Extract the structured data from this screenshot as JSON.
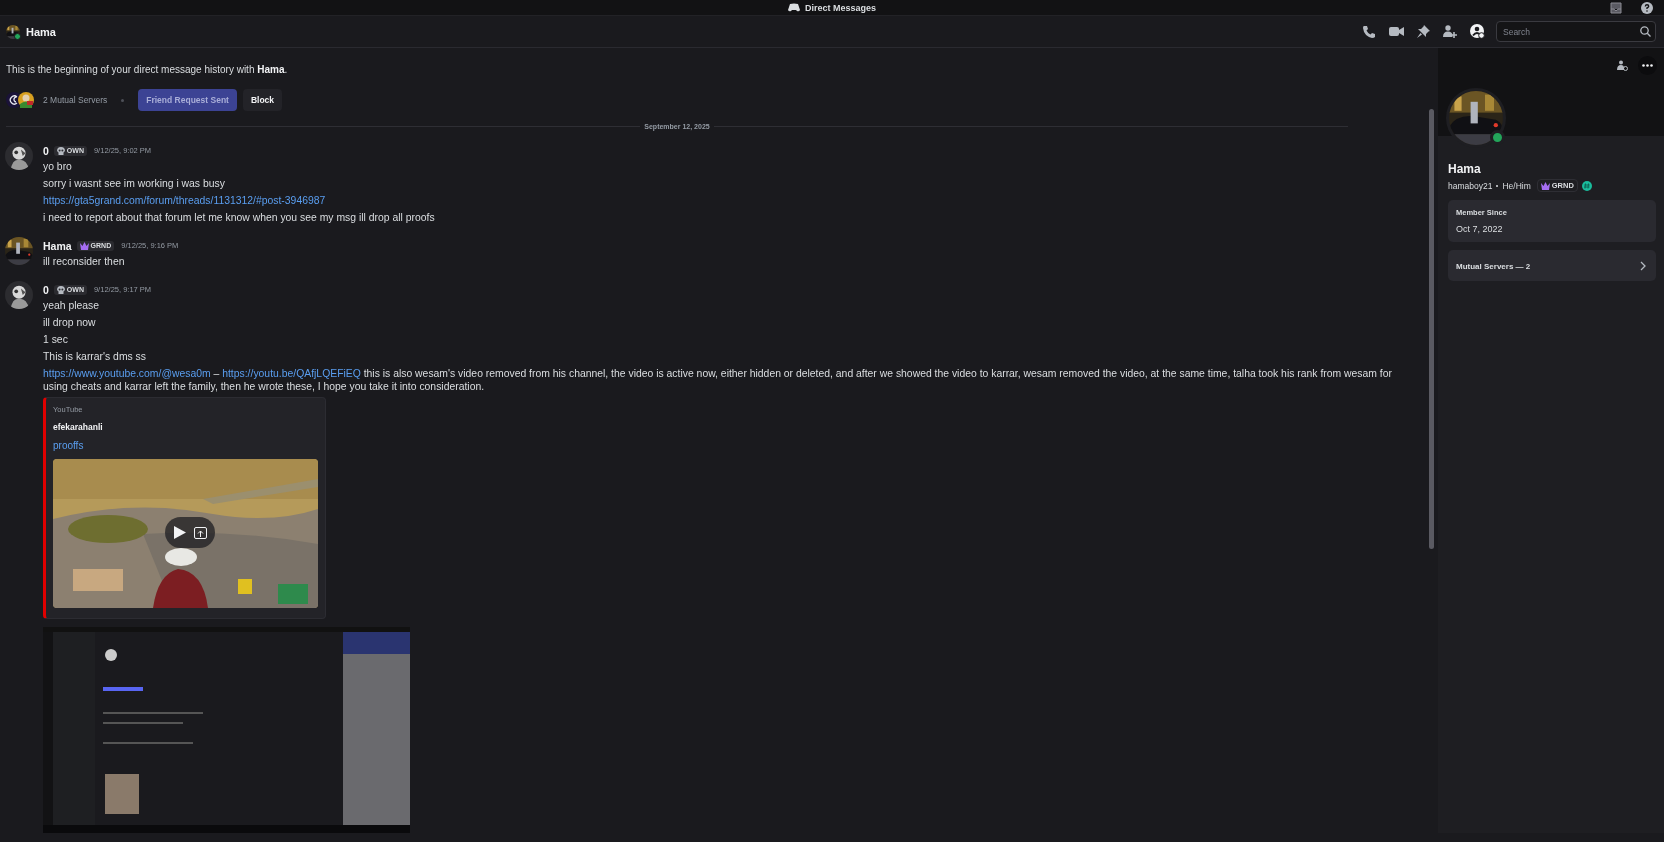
{
  "title_bar": {
    "title": "Direct Messages"
  },
  "header": {
    "name": "Hama",
    "online": true,
    "search": {
      "placeholder": "Search"
    }
  },
  "intro": {
    "text": "This is the beginning of your direct message history with **Hama**.",
    "mutual_servers": "2 Mutual Servers",
    "buttons": [
      {
        "label": "Friend Request Sent",
        "kind": "primary"
      },
      {
        "label": "Block",
        "kind": "secondary"
      }
    ]
  },
  "date_divider": "September 12, 2025",
  "messages": [
    {
      "author": "0",
      "tag": {
        "kind": "skull",
        "label": "OWN"
      },
      "time": "9/12/25, 9:02 PM",
      "lines": [
        [
          {
            "text": "yo bro",
            "link": false
          }
        ],
        [
          {
            "text": "sorry i wasnt see im working i was busy",
            "link": false
          }
        ],
        [
          {
            "text": "https://gta5grand.com/forum/threads/1131312/#post-3946987",
            "link": true
          }
        ],
        [
          {
            "text": "i need to report about that forum let me know when you see my msg ill drop all proofs",
            "link": false
          }
        ]
      ]
    },
    {
      "author": "Hama",
      "tag": {
        "kind": "crown",
        "label": "GRND"
      },
      "time": "9/12/25, 9:16 PM",
      "lines": [
        [
          {
            "text": "ill reconsider then",
            "link": false
          }
        ]
      ]
    },
    {
      "author": "0",
      "tag": {
        "kind": "skull",
        "label": "OWN"
      },
      "time": "9/12/25, 9:17 PM",
      "lines": [
        [
          {
            "text": "yeah please",
            "link": false
          }
        ],
        [
          {
            "text": "ill drop now",
            "link": false
          }
        ],
        [
          {
            "text": "1 sec",
            "link": false
          }
        ],
        [
          {
            "text": "This is karrar's dms ss",
            "link": false
          }
        ],
        [
          {
            "text": "https://www.youtube.com/@wesa0m",
            "link": true
          },
          {
            "text": " – ",
            "link": false
          },
          {
            "text": "https://youtu.be/QAfjLQEFiEQ",
            "link": true
          },
          {
            "text": " this is also wesam's video removed from his channel, the video is active now, either hidden or deleted, and after we showed the video to karrar, wesam removed the video, at the same time, talha took his rank from wesam for using cheats and karrar left the family, then he wrote these, I hope you take it into consideration.",
            "link": false
          }
        ]
      ],
      "embed": {
        "provider": "YouTube",
        "author": "efekarahanli",
        "title": "prooffs",
        "thumbnail": {
          "kind": "picture"
        }
      },
      "attachment": {
        "kind": "picture"
      }
    }
  ],
  "profile": {
    "name": "Hama",
    "online": true,
    "username": "hamaboy21",
    "pronouns": "He/Him",
    "tag": {
      "kind": "crown",
      "label": "GRND"
    },
    "member_since_label": "Member Since",
    "member_since": "Oct 7, 2022",
    "mutual_servers": "Mutual Servers — 2"
  }
}
